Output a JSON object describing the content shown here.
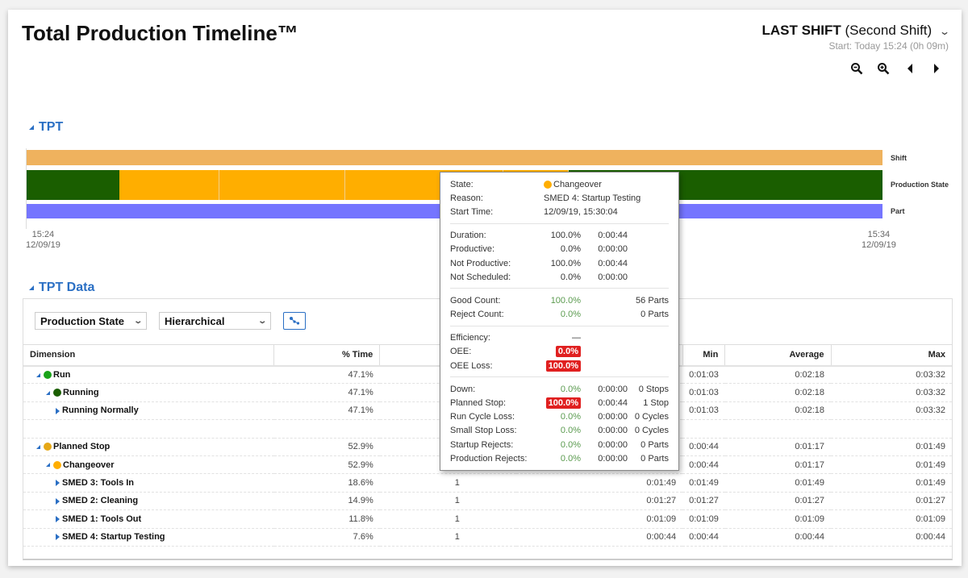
{
  "header": {
    "title": "Total Production Timeline™",
    "shift_bold": "LAST SHIFT",
    "shift_name": "(Second Shift)",
    "shift_sub": "Start: Today 15:24 (0h 09m)"
  },
  "toolbar": {
    "zoom_out_icon": "zoom-out-icon",
    "zoom_in_icon": "zoom-in-icon",
    "prev_icon": "triangle-left-icon",
    "next_icon": "triangle-right-icon"
  },
  "tpt": {
    "section_title": "TPT",
    "tracks": [
      "Shift",
      "Production State",
      "Part"
    ],
    "colors": {
      "shift": "#efb25e",
      "run": "#1a5e00",
      "changeover": "#ffae00",
      "part": "#7575ff"
    },
    "state_segments": [
      {
        "state": "Running",
        "start_fraction": 0.0,
        "end_fraction": 0.108
      },
      {
        "state": "Changeover",
        "start_fraction": 0.108,
        "end_fraction": 0.225
      },
      {
        "state": "Changeover",
        "start_fraction": 0.225,
        "end_fraction": 0.372
      },
      {
        "state": "Changeover",
        "start_fraction": 0.372,
        "end_fraction": 0.557
      },
      {
        "state": "Changeover",
        "start_fraction": 0.557,
        "end_fraction": 0.633
      },
      {
        "state": "Running",
        "start_fraction": 0.633,
        "end_fraction": 1.0
      }
    ],
    "start_time": "15:24",
    "start_date": "12/09/19",
    "end_time": "15:34",
    "end_date": "12/09/19"
  },
  "tooltip": {
    "state_label": "State:",
    "state_value": "Changeover",
    "reason_label": "Reason:",
    "reason_value": "SMED 4: Startup Testing",
    "start_label": "Start Time:",
    "start_value": "12/09/19, 15:30:04",
    "time_rows": [
      {
        "label": "Duration:",
        "pct": "100.0%",
        "time": "0:00:44"
      },
      {
        "label": "Productive:",
        "pct": "0.0%",
        "time": "0:00:00"
      },
      {
        "label": "Not Productive:",
        "pct": "100.0%",
        "time": "0:00:44"
      },
      {
        "label": "Not Scheduled:",
        "pct": "0.0%",
        "time": "0:00:00"
      }
    ],
    "count_rows": [
      {
        "label": "Good Count:",
        "pct": "100.0%",
        "extra": "56 Parts"
      },
      {
        "label": "Reject Count:",
        "pct": "0.0%",
        "extra": "0 Parts"
      }
    ],
    "eff_rows": [
      {
        "label": "Efficiency:",
        "value": "—"
      },
      {
        "label": "OEE:",
        "value": "0.0%"
      },
      {
        "label": "OEE Loss:",
        "value": "100.0%"
      }
    ],
    "loss_rows": [
      {
        "label": "Down:",
        "pct": "0.0%",
        "time": "0:00:00",
        "extra": "0 Stops"
      },
      {
        "label": "Planned Stop:",
        "pct": "100.0%",
        "time": "0:00:44",
        "extra": "1 Stop"
      },
      {
        "label": "Run Cycle Loss:",
        "pct": "0.0%",
        "time": "0:00:00",
        "extra": "0 Cycles"
      },
      {
        "label": "Small Stop Loss:",
        "pct": "0.0%",
        "time": "0:00:00",
        "extra": "0 Cycles"
      },
      {
        "label": "Startup Rejects:",
        "pct": "0.0%",
        "time": "0:00:00",
        "extra": "0 Parts"
      },
      {
        "label": "Production Rejects:",
        "pct": "0.0%",
        "time": "0:00:00",
        "extra": "0 Parts"
      }
    ]
  },
  "tpt_data": {
    "section_title": "TPT Data",
    "dimension_select": "Production State",
    "mode_select": "Hierarchical",
    "columns": [
      "Dimension",
      "% Time",
      "",
      "",
      "Min",
      "Average",
      "Max"
    ],
    "rows": [
      {
        "name": "Run",
        "level": 0,
        "dot": "#1aa31a",
        "pct": "47.1%",
        "c3": "",
        "c4": "",
        "min": "0:01:03",
        "avg": "0:02:18",
        "max": "0:03:32"
      },
      {
        "name": "Running",
        "level": 1,
        "dot": "#1a5e00",
        "pct": "47.1%",
        "c3": "",
        "c4": "",
        "min": "0:01:03",
        "avg": "0:02:18",
        "max": "0:03:32"
      },
      {
        "name": "Running Normally",
        "level": 2,
        "dot": "",
        "pct": "47.1%",
        "c3": "",
        "c4": "",
        "min": "0:01:03",
        "avg": "0:02:18",
        "max": "0:03:32"
      },
      {
        "spacer": true
      },
      {
        "name": "Planned Stop",
        "level": 0,
        "dot": "#e6a817",
        "pct": "52.9%",
        "c3": "",
        "c4": "",
        "min": "0:00:44",
        "avg": "0:01:17",
        "max": "0:01:49"
      },
      {
        "name": "Changeover",
        "level": 1,
        "dot": "#ffae00",
        "pct": "52.9%",
        "c3": "",
        "c4": "",
        "min": "0:00:44",
        "avg": "0:01:17",
        "max": "0:01:49"
      },
      {
        "name": "SMED 3: Tools In",
        "level": 2,
        "dot": "",
        "pct": "18.6%",
        "c3": "1",
        "c4": "0:01:49",
        "min": "0:01:49",
        "avg": "0:01:49",
        "max": "0:01:49"
      },
      {
        "name": "SMED 2: Cleaning",
        "level": 2,
        "dot": "",
        "pct": "14.9%",
        "c3": "1",
        "c4": "0:01:27",
        "min": "0:01:27",
        "avg": "0:01:27",
        "max": "0:01:27"
      },
      {
        "name": "SMED 1: Tools Out",
        "level": 2,
        "dot": "",
        "pct": "11.8%",
        "c3": "1",
        "c4": "0:01:09",
        "min": "0:01:09",
        "avg": "0:01:09",
        "max": "0:01:09"
      },
      {
        "name": "SMED 4: Startup Testing",
        "level": 2,
        "dot": "",
        "pct": "7.6%",
        "c3": "1",
        "c4": "0:00:44",
        "min": "0:00:44",
        "avg": "0:00:44",
        "max": "0:00:44"
      }
    ]
  }
}
